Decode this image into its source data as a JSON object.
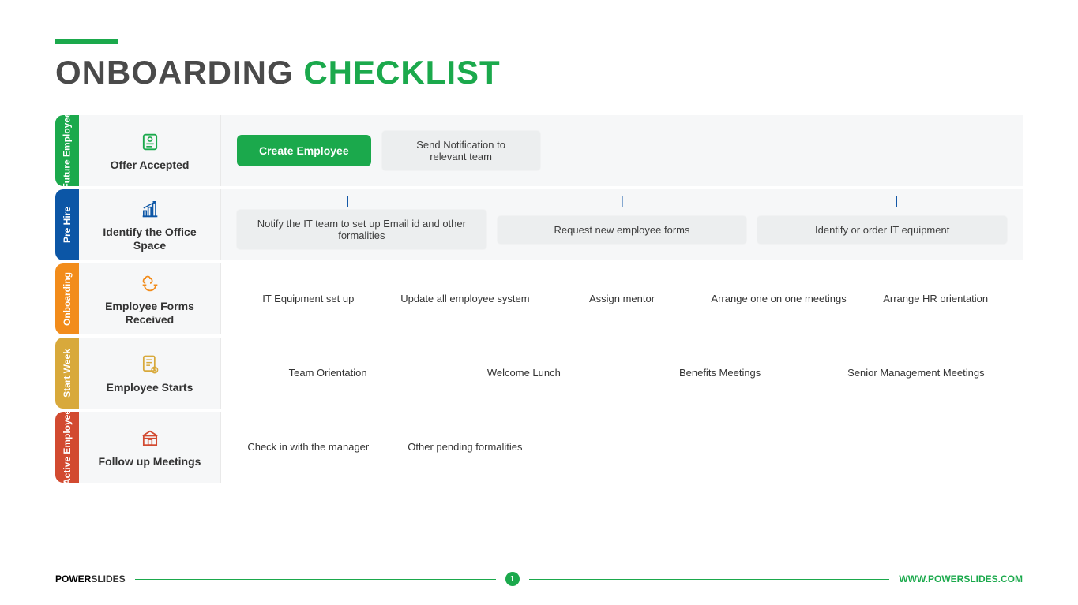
{
  "title": {
    "part1": "ONBOARDING ",
    "part2": "CHECKLIST"
  },
  "rows": [
    {
      "tab": "Future Employee",
      "color": "#1ba94c",
      "head": "Offer Accepted",
      "type": "shaded",
      "items": [
        {
          "style": "btn",
          "text": "Create Employee"
        },
        {
          "style": "pill",
          "text": "Send Notification to relevant team"
        }
      ]
    },
    {
      "tab": "Pre Hire",
      "color": "#0c56a6",
      "head": "Identify the Office Space",
      "type": "shaded",
      "items": [
        {
          "style": "pillwide",
          "text": "Notify the IT team to set up Email id and other formalities"
        },
        {
          "style": "pillwide",
          "text": "Request new employee forms"
        },
        {
          "style": "pillwide",
          "text": "Identify or order IT equipment"
        }
      ]
    },
    {
      "tab": "Onboarding",
      "color": "#f28c1b",
      "head": "Employee Forms Received",
      "type": "plain",
      "items": [
        {
          "style": "txt",
          "text": "IT Equipment set up"
        },
        {
          "style": "txt",
          "text": "Update all employee system"
        },
        {
          "style": "txt",
          "text": "Assign mentor"
        },
        {
          "style": "txt",
          "text": "Arrange one on one meetings"
        },
        {
          "style": "txt",
          "text": "Arrange HR orientation"
        }
      ]
    },
    {
      "tab": "Start Week",
      "color": "#d8a93b",
      "head": "Employee Starts",
      "type": "plain",
      "items": [
        {
          "style": "txt",
          "text": "Team Orientation"
        },
        {
          "style": "txt",
          "text": "Welcome Lunch"
        },
        {
          "style": "txt",
          "text": "Benefits Meetings"
        },
        {
          "style": "txt",
          "text": "Senior Management Meetings"
        }
      ]
    },
    {
      "tab": "Active Employee",
      "color": "#d24a30",
      "head": "Follow up Meetings",
      "type": "plain",
      "items": [
        {
          "style": "txt",
          "text": "Check in with the manager"
        },
        {
          "style": "txt",
          "text": "Other pending formalities"
        },
        {
          "style": "txt",
          "text": ""
        },
        {
          "style": "txt",
          "text": ""
        },
        {
          "style": "txt",
          "text": ""
        }
      ]
    }
  ],
  "footer": {
    "brand1": "POWER",
    "brand2": "SLIDES",
    "page": "1",
    "url": "WWW.POWERSLIDES.COM"
  },
  "icons": {
    "r0": "#1ba94c",
    "r1": "#0c56a6",
    "r2": "#f28c1b",
    "r3": "#d8a93b",
    "r4": "#d24a30"
  }
}
